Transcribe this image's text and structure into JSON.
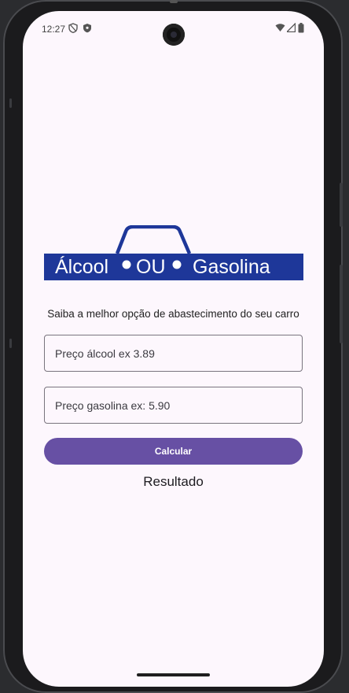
{
  "status_bar": {
    "time": "12:27",
    "left_icons": [
      "shield-icon",
      "security-badge-icon"
    ],
    "right_icons": [
      "wifi-icon",
      "signal-icon",
      "battery-icon"
    ]
  },
  "logo": {
    "word_left": "Álcool",
    "word_middle": "OU",
    "word_right": "Gasolina",
    "brand_color": "#1e3799"
  },
  "subtitle": "Saiba a melhor opção de abastecimento do seu carro",
  "inputs": {
    "alcool_placeholder": "Preço álcool ex 3.89",
    "alcool_value": "",
    "gasolina_placeholder": "Preço gasolina ex: 5.90",
    "gasolina_value": ""
  },
  "calculate_button": {
    "label": "Calcular",
    "color": "#6750a4"
  },
  "result_label": "Resultado"
}
